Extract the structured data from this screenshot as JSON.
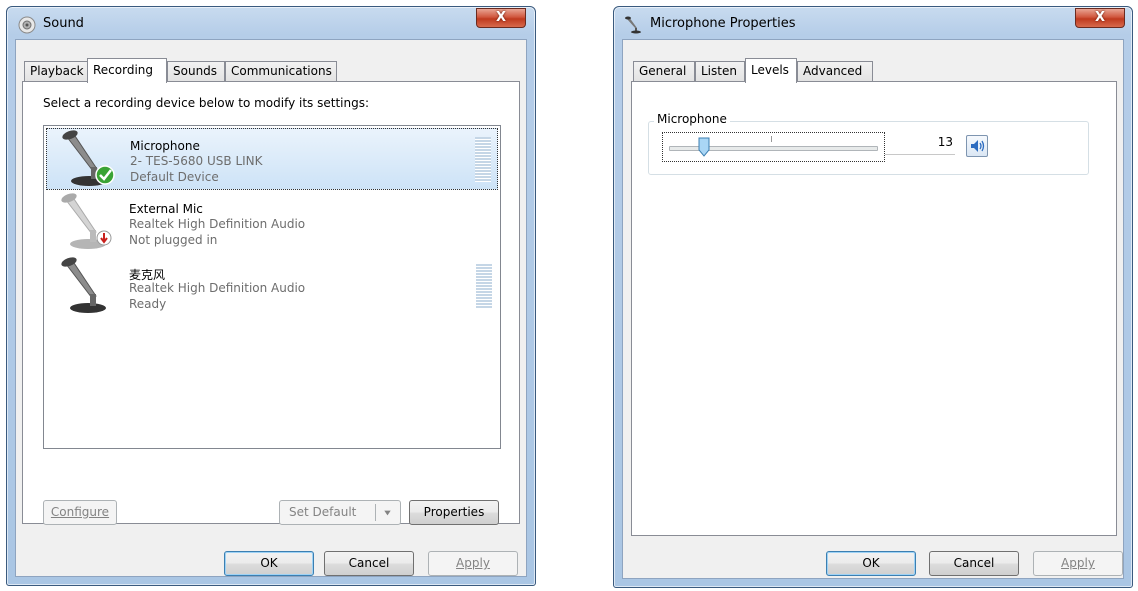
{
  "sound_dialog": {
    "title": "Sound",
    "close_label": "X",
    "tabs": [
      {
        "label": "Playback"
      },
      {
        "label": "Recording",
        "active": true
      },
      {
        "label": "Sounds"
      },
      {
        "label": "Communications"
      }
    ],
    "instruction": "Select a recording device below to modify its settings:",
    "devices": [
      {
        "name": "Microphone",
        "line1": "2- TES-5680 USB LINK",
        "line2": "Default Device",
        "selected": true,
        "status_icon": "check-icon",
        "meter": true
      },
      {
        "name": "External Mic",
        "line1": "Realtek High Definition Audio",
        "line2": "Not plugged in",
        "status_icon": "unplugged-icon",
        "meter": false
      },
      {
        "name": "麦克风",
        "line1": "Realtek High Definition Audio",
        "line2": "Ready",
        "meter": true
      }
    ],
    "buttons": {
      "configure": "Configure",
      "set_default": "Set Default",
      "properties": "Properties",
      "ok": "OK",
      "cancel": "Cancel",
      "apply": "Apply"
    }
  },
  "mic_dialog": {
    "title": "Microphone Properties",
    "close_label": "X",
    "tabs": [
      {
        "label": "General"
      },
      {
        "label": "Listen"
      },
      {
        "label": "Levels",
        "active": true
      },
      {
        "label": "Advanced"
      }
    ],
    "group_label": "Microphone",
    "level_value": "13",
    "level_fraction": 0.13,
    "buttons": {
      "ok": "OK",
      "cancel": "Cancel",
      "apply": "Apply"
    }
  },
  "colors": {
    "selection": "#cde3f7",
    "check_green": "#3aa335",
    "unplug_red": "#c8201c",
    "slider_thumb": "#5aa9e0"
  }
}
